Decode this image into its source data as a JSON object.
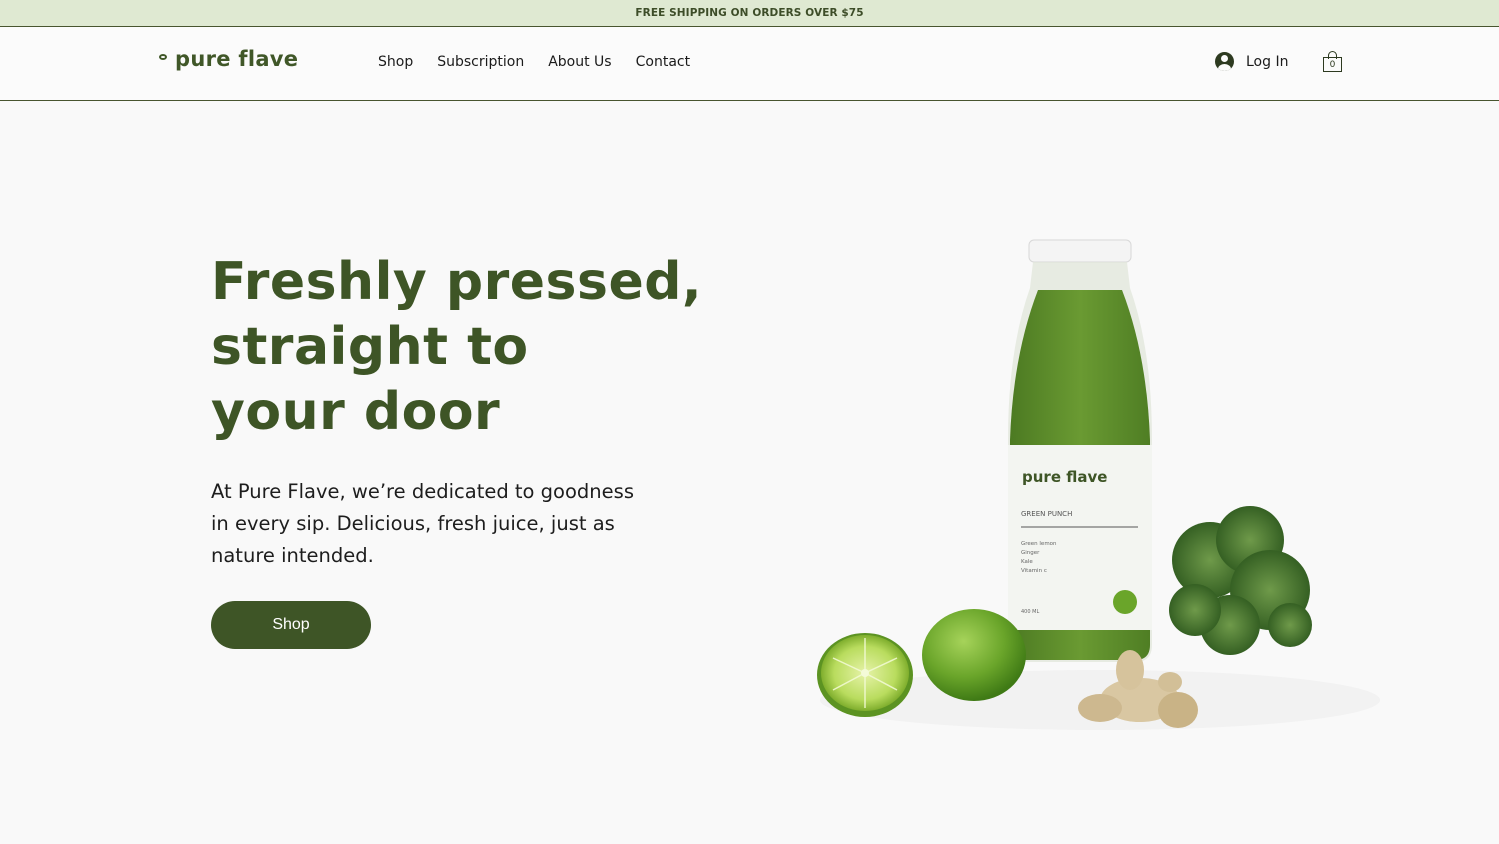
{
  "announcement": {
    "text": "FREE SHIPPING ON ORDERS OVER $75"
  },
  "header": {
    "logo_text": "pure flave",
    "nav": [
      {
        "label": "Shop"
      },
      {
        "label": "Subscription"
      },
      {
        "label": "About Us"
      },
      {
        "label": "Contact"
      }
    ],
    "login_label": "Log In",
    "cart_count": "0"
  },
  "hero": {
    "title_lines": [
      "Freshly pressed,",
      "straight to",
      "your door"
    ],
    "body": "At Pure Flave, we’re dedicated to goodness in every sip. Delicious, fresh juice, just as nature intended.",
    "cta_label": "Shop"
  },
  "product_image": {
    "brand": "pure flave",
    "name": "GREEN PUNCH",
    "ingredients": [
      "Green lemon",
      "Ginger",
      "Kale",
      "Vitamin c"
    ],
    "volume": "400 ML"
  },
  "colors": {
    "brand_green": "#3e5526",
    "announcement_bg": "#dfe9d2",
    "page_bg": "#f9f9f9"
  }
}
